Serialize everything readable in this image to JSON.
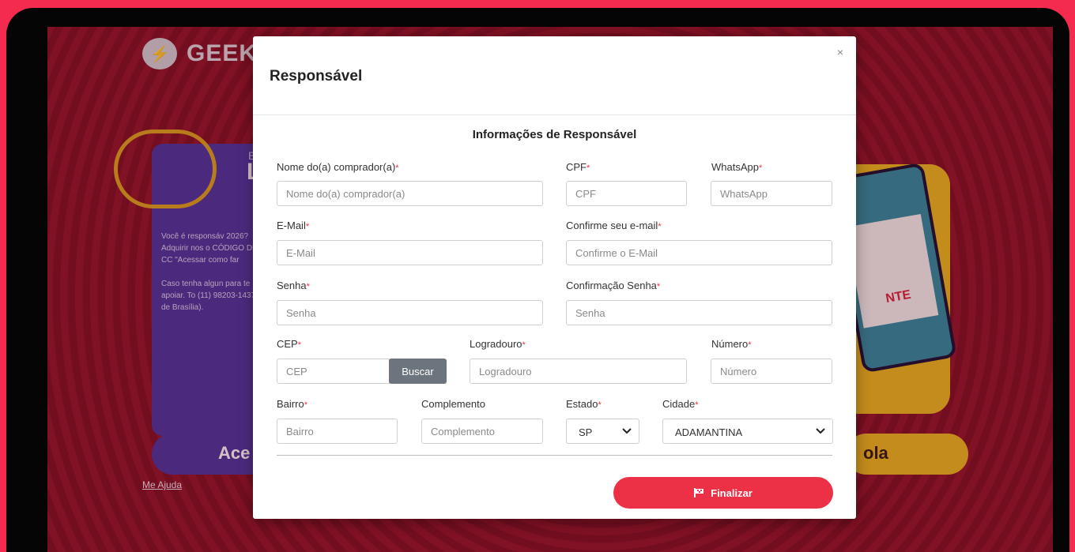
{
  "background": {
    "logo_text": "GEEK",
    "card_line_small": "B",
    "card_line_big": "L",
    "card_text": "Você é responsáv 2026? Adquirir nos o CÓDIGO DE CC \"Acessar como far\n\nCaso tenha algun para te apoiar. To (11) 98203-1437, (d de Brasília).",
    "left_button": "Ace",
    "help_link": "Me Ajuda",
    "right_button": "ola",
    "device_text": "NTE"
  },
  "modal": {
    "title": "Responsável",
    "close_label": "×",
    "section_title": "Informações de Responsável",
    "required_mark": "*",
    "fields": {
      "nome": {
        "label": "Nome do(a) comprador(a)",
        "placeholder": "Nome do(a) comprador(a)"
      },
      "cpf": {
        "label": "CPF",
        "placeholder": "CPF"
      },
      "whatsapp": {
        "label": "WhatsApp",
        "placeholder": "WhatsApp"
      },
      "email": {
        "label": "E-Mail",
        "placeholder": "E-Mail"
      },
      "confirm_email": {
        "label": "Confirme seu e-mail",
        "placeholder": "Confirme o E-Mail"
      },
      "senha": {
        "label": "Senha",
        "placeholder": "Senha"
      },
      "confirm_senha": {
        "label": "Confirmação Senha",
        "placeholder": "Senha"
      },
      "cep": {
        "label": "CEP",
        "placeholder": "CEP"
      },
      "logradouro": {
        "label": "Logradouro",
        "placeholder": "Logradouro"
      },
      "numero": {
        "label": "Número",
        "placeholder": "Número"
      },
      "bairro": {
        "label": "Bairro",
        "placeholder": "Bairro"
      },
      "complemento": {
        "label": "Complemento",
        "placeholder": "Complemento"
      },
      "estado": {
        "label": "Estado",
        "value": "SP"
      },
      "cidade": {
        "label": "Cidade",
        "value": "ADAMANTINA"
      }
    },
    "buscar_label": "Buscar",
    "finalizar_label": "Finalizar"
  },
  "colors": {
    "accent": "#ec3146",
    "buscar": "#6c757d",
    "page_bg": "#f42b4e"
  }
}
